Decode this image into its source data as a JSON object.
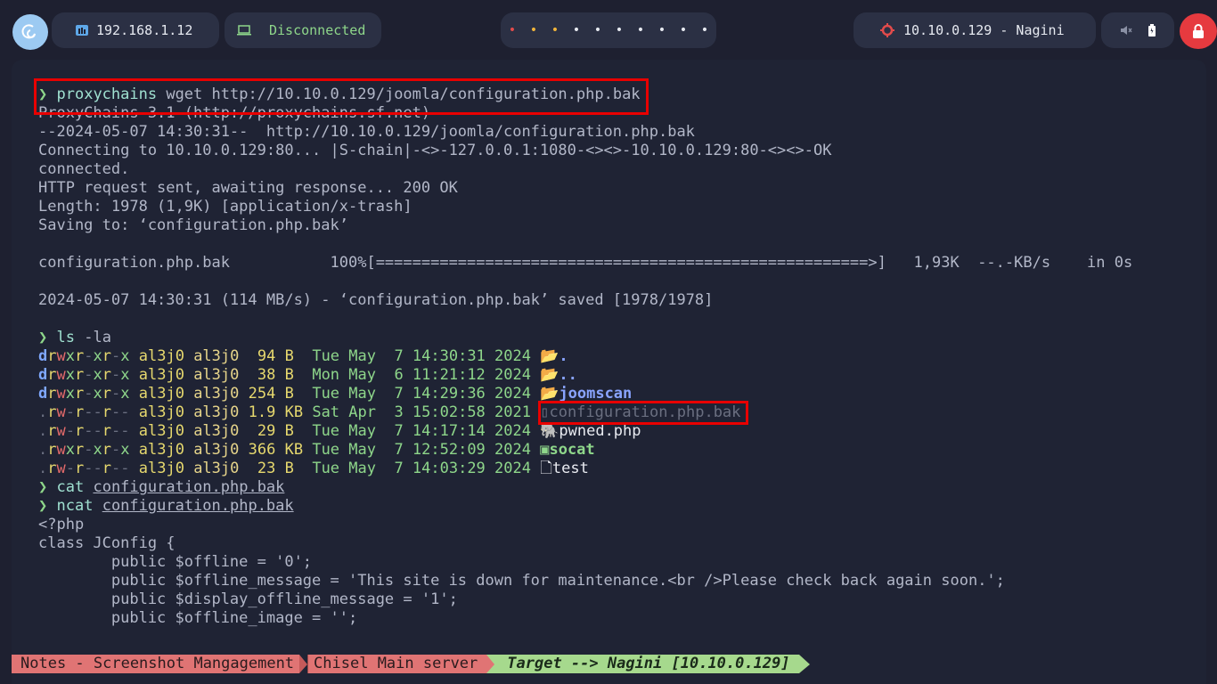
{
  "topbar": {
    "ip": "192.168.1.12",
    "vpn_status": "Disconnected",
    "workspaces": [
      "•",
      "•",
      "•",
      "•",
      "•",
      "•",
      "•",
      "•",
      "•",
      "•"
    ],
    "workspace_colors": [
      "#e24b4b",
      "#f0b43b",
      "#f0b43b",
      "#e6e9f0",
      "#e6e9f0",
      "#e6e9f0",
      "#e6e9f0",
      "#e6e9f0",
      "#e6e9f0",
      "#e6e9f0"
    ],
    "target": "10.10.0.129 - Nagini"
  },
  "terminal": {
    "cmd1_prompt": "❯",
    "cmd1_bin": "proxychains",
    "cmd1_args": " wget http://10.10.0.129/joomla/configuration.php.bak",
    "out": [
      "ProxyChains-3.1 (http://proxychains.sf.net)",
      "--2024-05-07 14:30:31--  http://10.10.0.129/joomla/configuration.php.bak",
      "Connecting to 10.10.0.129:80... |S-chain|-<>-127.0.0.1:1080-<><>-10.10.0.129:80-<><>-OK",
      "connected.",
      "HTTP request sent, awaiting response... 200 OK",
      "Length: 1978 (1,9K) [application/x-trash]",
      "Saving to: ‘configuration.php.bak’",
      "",
      "configuration.php.bak           100%[======================================================>]   1,93K  --.-KB/s    in 0s",
      "",
      "2024-05-07 14:30:31 (114 MB/s) - ‘configuration.php.bak’ saved [1978/1978]",
      ""
    ],
    "cmd2_bin": "ls",
    "cmd2_args": " -la",
    "ls_rows": [
      {
        "perm_d": "d",
        "perm_rest": "rwxr-xr-x",
        "user": "al3j0",
        "group": "al3j0",
        "size": " 94",
        "unit": "B ",
        "date": "Tue May  7 14:30:31 2024",
        "icon": "📂",
        "name": ".",
        "type": "dir"
      },
      {
        "perm_d": "d",
        "perm_rest": "rwxr-xr-x",
        "user": "al3j0",
        "group": "al3j0",
        "size": " 38",
        "unit": "B ",
        "date": "Mon May  6 11:21:12 2024",
        "icon": "📂",
        "name": "..",
        "type": "dir"
      },
      {
        "perm_d": "d",
        "perm_rest": "rwxr-xr-x",
        "user": "al3j0",
        "group": "al3j0",
        "size": "254",
        "unit": "B ",
        "date": "Tue May  7 14:29:36 2024",
        "icon": "📂",
        "name": "joomscan",
        "type": "dir"
      },
      {
        "perm_d": ".",
        "perm_rest": "rw-r--r--",
        "user": "al3j0",
        "group": "al3j0",
        "size": "1.9",
        "unit": "KB",
        "date": "Sat Apr  3 15:02:58 2021",
        "icon": "▯",
        "name": "configuration.php.bak",
        "type": "muted"
      },
      {
        "perm_d": ".",
        "perm_rest": "rw-r--r--",
        "user": "al3j0",
        "group": "al3j0",
        "size": " 29",
        "unit": "B ",
        "date": "Tue May  7 14:17:14 2024",
        "icon": "🐘",
        "name": "pwned.php",
        "type": "file"
      },
      {
        "perm_d": ".",
        "perm_rest": "rwxr-xr-x",
        "user": "al3j0",
        "group": "al3j0",
        "size": "366",
        "unit": "KB",
        "date": "Tue May  7 12:52:09 2024",
        "icon": "▣",
        "name": "socat",
        "type": "exec"
      },
      {
        "perm_d": ".",
        "perm_rest": "rw-r--r--",
        "user": "al3j0",
        "group": "al3j0",
        "size": " 23",
        "unit": "B ",
        "date": "Tue May  7 14:03:29 2024",
        "icon": "🗋",
        "name": "test",
        "type": "file"
      }
    ],
    "cmd3_bin": "cat",
    "cmd3_arg": "configuration.php.bak",
    "cmd4_bin": "ncat",
    "cmd4_arg": "configuration.php.bak",
    "php": [
      "<?php",
      "class JConfig {",
      "        public $offline = '0';",
      "        public $offline_message = 'This site is down for maintenance.<br />Please check back again soon.';",
      "        public $display_offline_message = '1';",
      "        public $offline_image = '';"
    ]
  },
  "statusbar": {
    "seg1": "Notes - Screenshot Mangagement",
    "seg2": "Chisel Main server",
    "seg3": "Target --> Nagini [10.10.0.129]"
  },
  "colors": {
    "accent_green": "#8ed68a",
    "highlight_red": "#e80000",
    "lock_red": "#e63a3f"
  }
}
